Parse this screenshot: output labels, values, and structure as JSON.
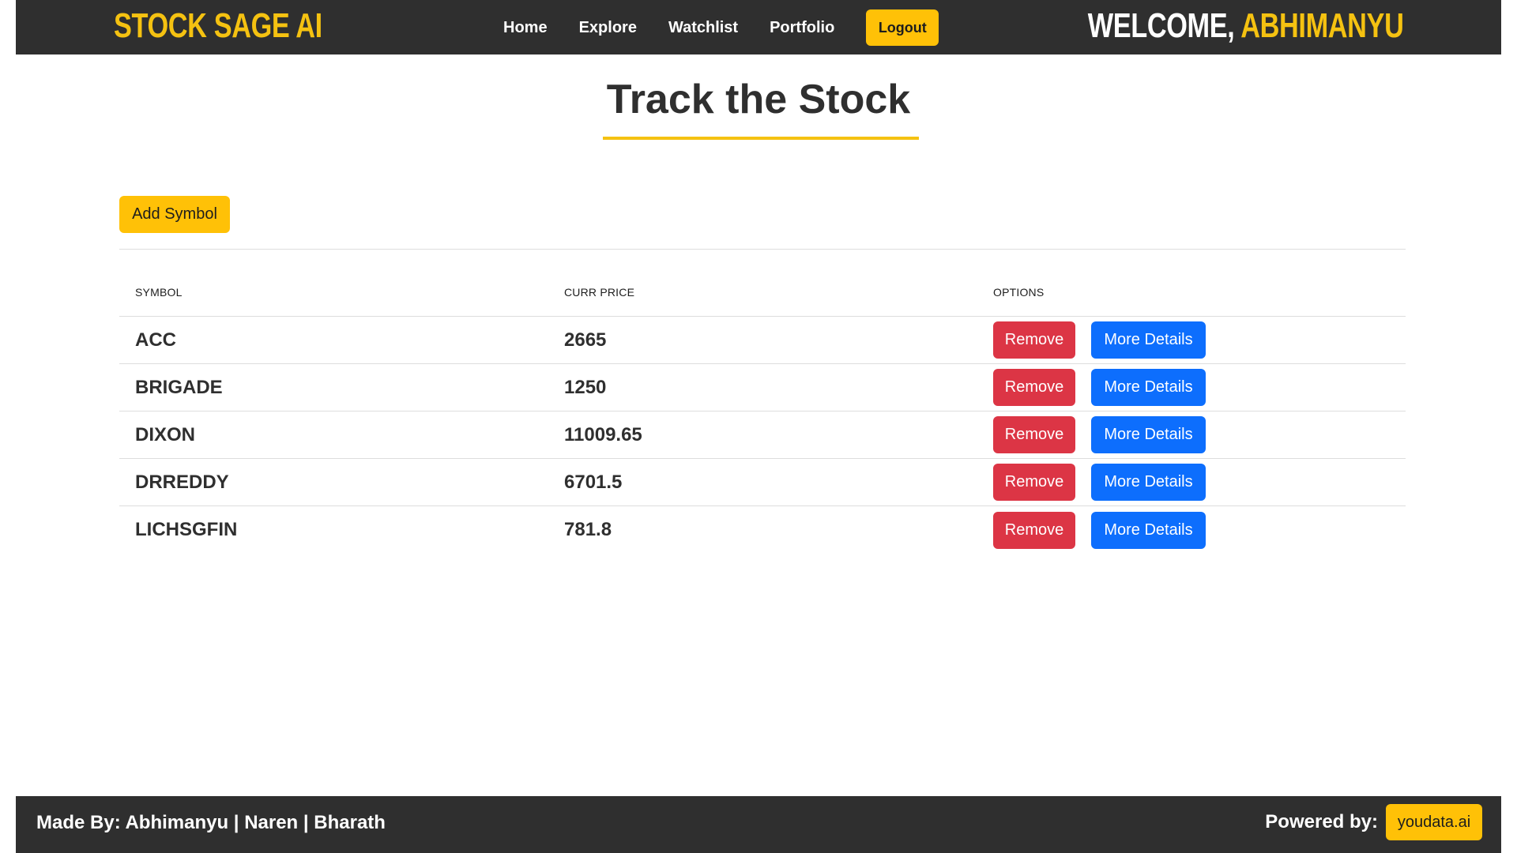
{
  "navbar": {
    "brand": "STOCK SAGE AI",
    "links": [
      "Home",
      "Explore",
      "Watchlist",
      "Portfolio"
    ],
    "logout_label": "Logout",
    "welcome_prefix": "WELCOME,",
    "welcome_user": "ABHIMANYU"
  },
  "main": {
    "title": "Track the Stock",
    "add_symbol_label": "Add Symbol",
    "table": {
      "headers": [
        "SYMBOL",
        "CURR PRICE",
        "OPTIONS"
      ],
      "rows": [
        {
          "symbol": "ACC",
          "price": "2665"
        },
        {
          "symbol": "BRIGADE",
          "price": "1250"
        },
        {
          "symbol": "DIXON",
          "price": "11009.65"
        },
        {
          "symbol": "DRREDDY",
          "price": "6701.5"
        },
        {
          "symbol": "LICHSGFIN",
          "price": "781.8"
        }
      ],
      "remove_label": "Remove",
      "details_label": "More Details"
    }
  },
  "footer": {
    "made_by": "Made By: Abhimanyu | Naren | Bharath",
    "powered_label": "Powered by:",
    "powered_badge": "youdata.ai"
  },
  "colors": {
    "dark": "#2f2f2f",
    "accent_yellow": "#ffc107",
    "danger_red": "#dc3545",
    "primary_blue": "#0d6efd"
  }
}
